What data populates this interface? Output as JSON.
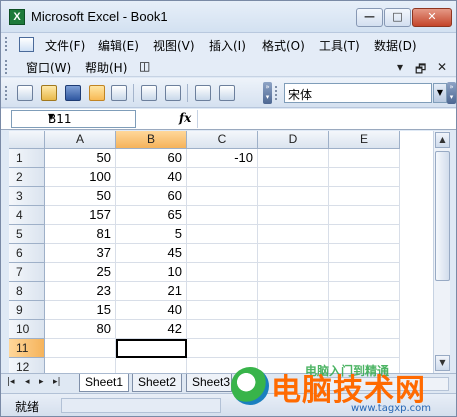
{
  "window": {
    "title": "Microsoft Excel - Book1",
    "app_icon_glyph": "X",
    "controls": {
      "minimize": "—",
      "maximize": "□",
      "close": "✕"
    }
  },
  "menubar": {
    "row1": [
      "文件(F)",
      "编辑(E)",
      "视图(V)",
      "插入(I)",
      "格式(O)",
      "工具(T)",
      "数据(D)"
    ],
    "row2": [
      "窗口(W)",
      "帮助(H)"
    ],
    "right_controls": [
      "▾",
      "🗗",
      "✕"
    ]
  },
  "toolbar": {
    "font_name": "宋体",
    "icons": [
      "new-icon",
      "open-icon",
      "save-icon",
      "permission-icon",
      "print-icon",
      "print-preview-icon",
      "spelling-icon",
      "research-icon"
    ]
  },
  "formula_bar": {
    "name_box": "B11",
    "fx": "fx",
    "formula": ""
  },
  "grid": {
    "columns": [
      "A",
      "B",
      "C",
      "D",
      "E"
    ],
    "selected_column": "B",
    "selected_row": "11",
    "rows": [
      {
        "row": "1",
        "cells": [
          "50",
          "60",
          "-10",
          "",
          ""
        ]
      },
      {
        "row": "2",
        "cells": [
          "100",
          "40",
          "",
          "",
          ""
        ]
      },
      {
        "row": "3",
        "cells": [
          "50",
          "60",
          "",
          "",
          ""
        ]
      },
      {
        "row": "4",
        "cells": [
          "157",
          "65",
          "",
          "",
          ""
        ]
      },
      {
        "row": "5",
        "cells": [
          "81",
          "5",
          "",
          "",
          ""
        ]
      },
      {
        "row": "6",
        "cells": [
          "37",
          "45",
          "",
          "",
          ""
        ]
      },
      {
        "row": "7",
        "cells": [
          "25",
          "10",
          "",
          "",
          ""
        ]
      },
      {
        "row": "8",
        "cells": [
          "23",
          "21",
          "",
          "",
          ""
        ]
      },
      {
        "row": "9",
        "cells": [
          "15",
          "40",
          "",
          "",
          ""
        ]
      },
      {
        "row": "10",
        "cells": [
          "80",
          "42",
          "",
          "",
          ""
        ]
      },
      {
        "row": "11",
        "cells": [
          "",
          "",
          "",
          "",
          ""
        ]
      },
      {
        "row": "12",
        "cells": [
          "",
          "",
          "",
          "",
          ""
        ]
      }
    ]
  },
  "sheets": {
    "tabs": [
      "Sheet1",
      "Sheet2",
      "Sheet3"
    ],
    "nav": [
      "|◂",
      "◂",
      "▸",
      "▸|"
    ]
  },
  "status": {
    "text": "就绪"
  },
  "watermark": {
    "text": "电脑技术网",
    "small": "电脑入门到精通",
    "url": "www.tagxp.com"
  },
  "colors": {
    "selected_header": "#f5b35b",
    "watermark_orange": "#ff6a00"
  }
}
